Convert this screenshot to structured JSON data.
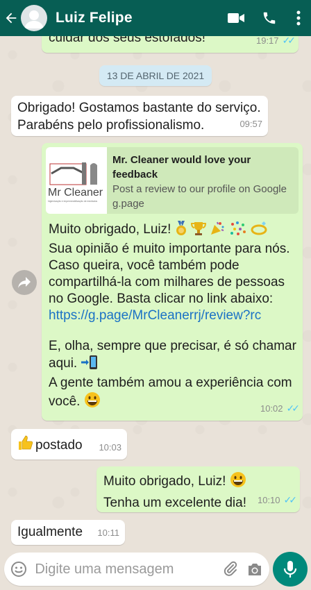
{
  "header": {
    "contact_name": "Luiz Felipe"
  },
  "chat": {
    "top_partial": {
      "text": "cuidar dos seus estofados!",
      "time": "19:17"
    },
    "date_chip": "13 DE ABRIL DE 2021",
    "msg1": {
      "line1": "Obrigado! Gostamos bastante do serviço.",
      "line2": "Parabéns pelo profissionalismo.",
      "time": "09:57"
    },
    "msg2": {
      "card_title_line1": "Mr. Cleaner would love your",
      "card_title_line2": "feedback",
      "card_desc": "Post a review to our profile on Google",
      "card_domain": "g.page",
      "logo_text": "Mr Cleaner",
      "logo_sub": "higienização e impermeabilização de estofados",
      "p1_line1": "Muito obrigado, Luiz!",
      "p1_line2": "Sua opinião é muito importante para nós.",
      "p1_line3": "Caso queira, você também pode",
      "p1_line4": "compartilhá-la com milhares de pessoas",
      "p1_line5": "no Google. Basta clicar no link abaixo:",
      "link": "https://g.page/MrCleanerrj/review?rc",
      "p2_line1": "E, olha, sempre que precisar, é só chamar",
      "p2_line2": "aqui.",
      "p3_line1": "A gente também amou a experiência com",
      "p3_line2": "você.",
      "time": "10:02"
    },
    "msg3": {
      "text": "postado",
      "time": "10:03"
    },
    "msg4": {
      "line1": "Muito obrigado, Luiz!",
      "line2": "Tenha um excelente dia!",
      "time": "10:10"
    },
    "msg5": {
      "text": "Igualmente",
      "time": "10:11"
    }
  },
  "composer": {
    "placeholder": "Digite uma mensagem"
  },
  "colors": {
    "header": "#075e54",
    "outgoing": "#dcf8c6",
    "incoming": "#ffffff",
    "read_ticks": "#4fc3f7",
    "mic": "#00897b"
  }
}
